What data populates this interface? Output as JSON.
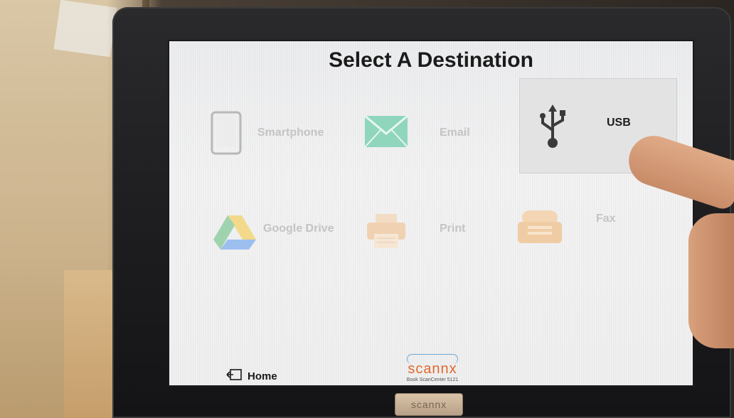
{
  "screen": {
    "title": "Select A Destination",
    "destinations": [
      {
        "label": "Smartphone",
        "icon": "smartphone-icon",
        "active": false
      },
      {
        "label": "Email",
        "icon": "envelope-icon",
        "active": false
      },
      {
        "label": "USB",
        "icon": "usb-icon",
        "active": true
      },
      {
        "label": "Google Drive",
        "icon": "google-drive-icon",
        "active": false
      },
      {
        "label": "Print",
        "icon": "printer-icon",
        "active": false
      },
      {
        "label": "Fax",
        "icon": "fax-icon",
        "active": false
      }
    ],
    "home_label": "Home",
    "brand": {
      "name": "scannx",
      "subtitle": "Book ScanCenter 5121"
    }
  },
  "device": {
    "logo": "scannx"
  },
  "colors": {
    "accent": "#e0682c",
    "email_green": "#6cc9a8",
    "cloud_blue": "#6fa8d6"
  }
}
